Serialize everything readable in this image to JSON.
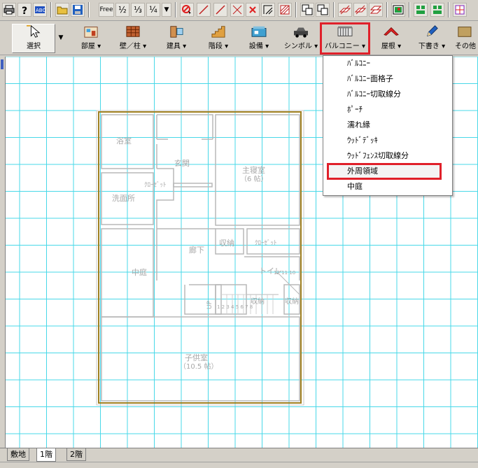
{
  "toolbar_small": {
    "free_label": "Free",
    "half_label": "½",
    "third_label": "⅓",
    "quarter_label": "¼"
  },
  "toolbar_main": {
    "select": "選択",
    "room": "部屋",
    "wall_pillar": "壁／柱",
    "fixtures": "建具",
    "stairs": "階段",
    "equipment": "設備",
    "symbol": "シンボル",
    "balcony": "バルコニー",
    "roof": "屋根",
    "draft": "下書き",
    "other": "その他"
  },
  "balcony_menu": {
    "items": [
      "ﾊﾞﾙｺﾆｰ",
      "ﾊﾞﾙｺﾆｰ面格子",
      "ﾊﾞﾙｺﾆｰ切取線分",
      "ﾎﾟｰﾁ",
      "濡れ縁",
      "ｳｯﾄﾞﾃﾞｯｷ",
      "ｳｯﾄﾞﾌｪﾝｽ切取線分",
      "外周領域",
      "中庭"
    ]
  },
  "floor_plan": {
    "bath": "浴室",
    "entrance": "玄関",
    "closet_small": "ｸﾛｰｾﾞｯﾄ",
    "washroom": "洗面所",
    "master_bedroom": "主寝室",
    "master_bedroom_size": "（6 帖）",
    "hallway": "廊下",
    "storage": "収納",
    "closet": "ｸﾛｰｾﾞｯﾄ",
    "courtyard": "中庭",
    "toilet": "トイレ",
    "up": "UP",
    "storage2": "収納",
    "storage3": "収納",
    "kids_room": "子供室",
    "kids_room_size": "（10.5 帖）",
    "stair_nums": "1 2 3 4 5 6 7 8",
    "stair_nums2": "12 11 10"
  },
  "tabs": {
    "site": "敷地",
    "floor1": "1階",
    "floor2": "2階"
  },
  "colors": {
    "grid": "#48d8e8",
    "outline": "#a08020",
    "plan_line": "#b8b8b8",
    "highlight": "#e0202a"
  }
}
